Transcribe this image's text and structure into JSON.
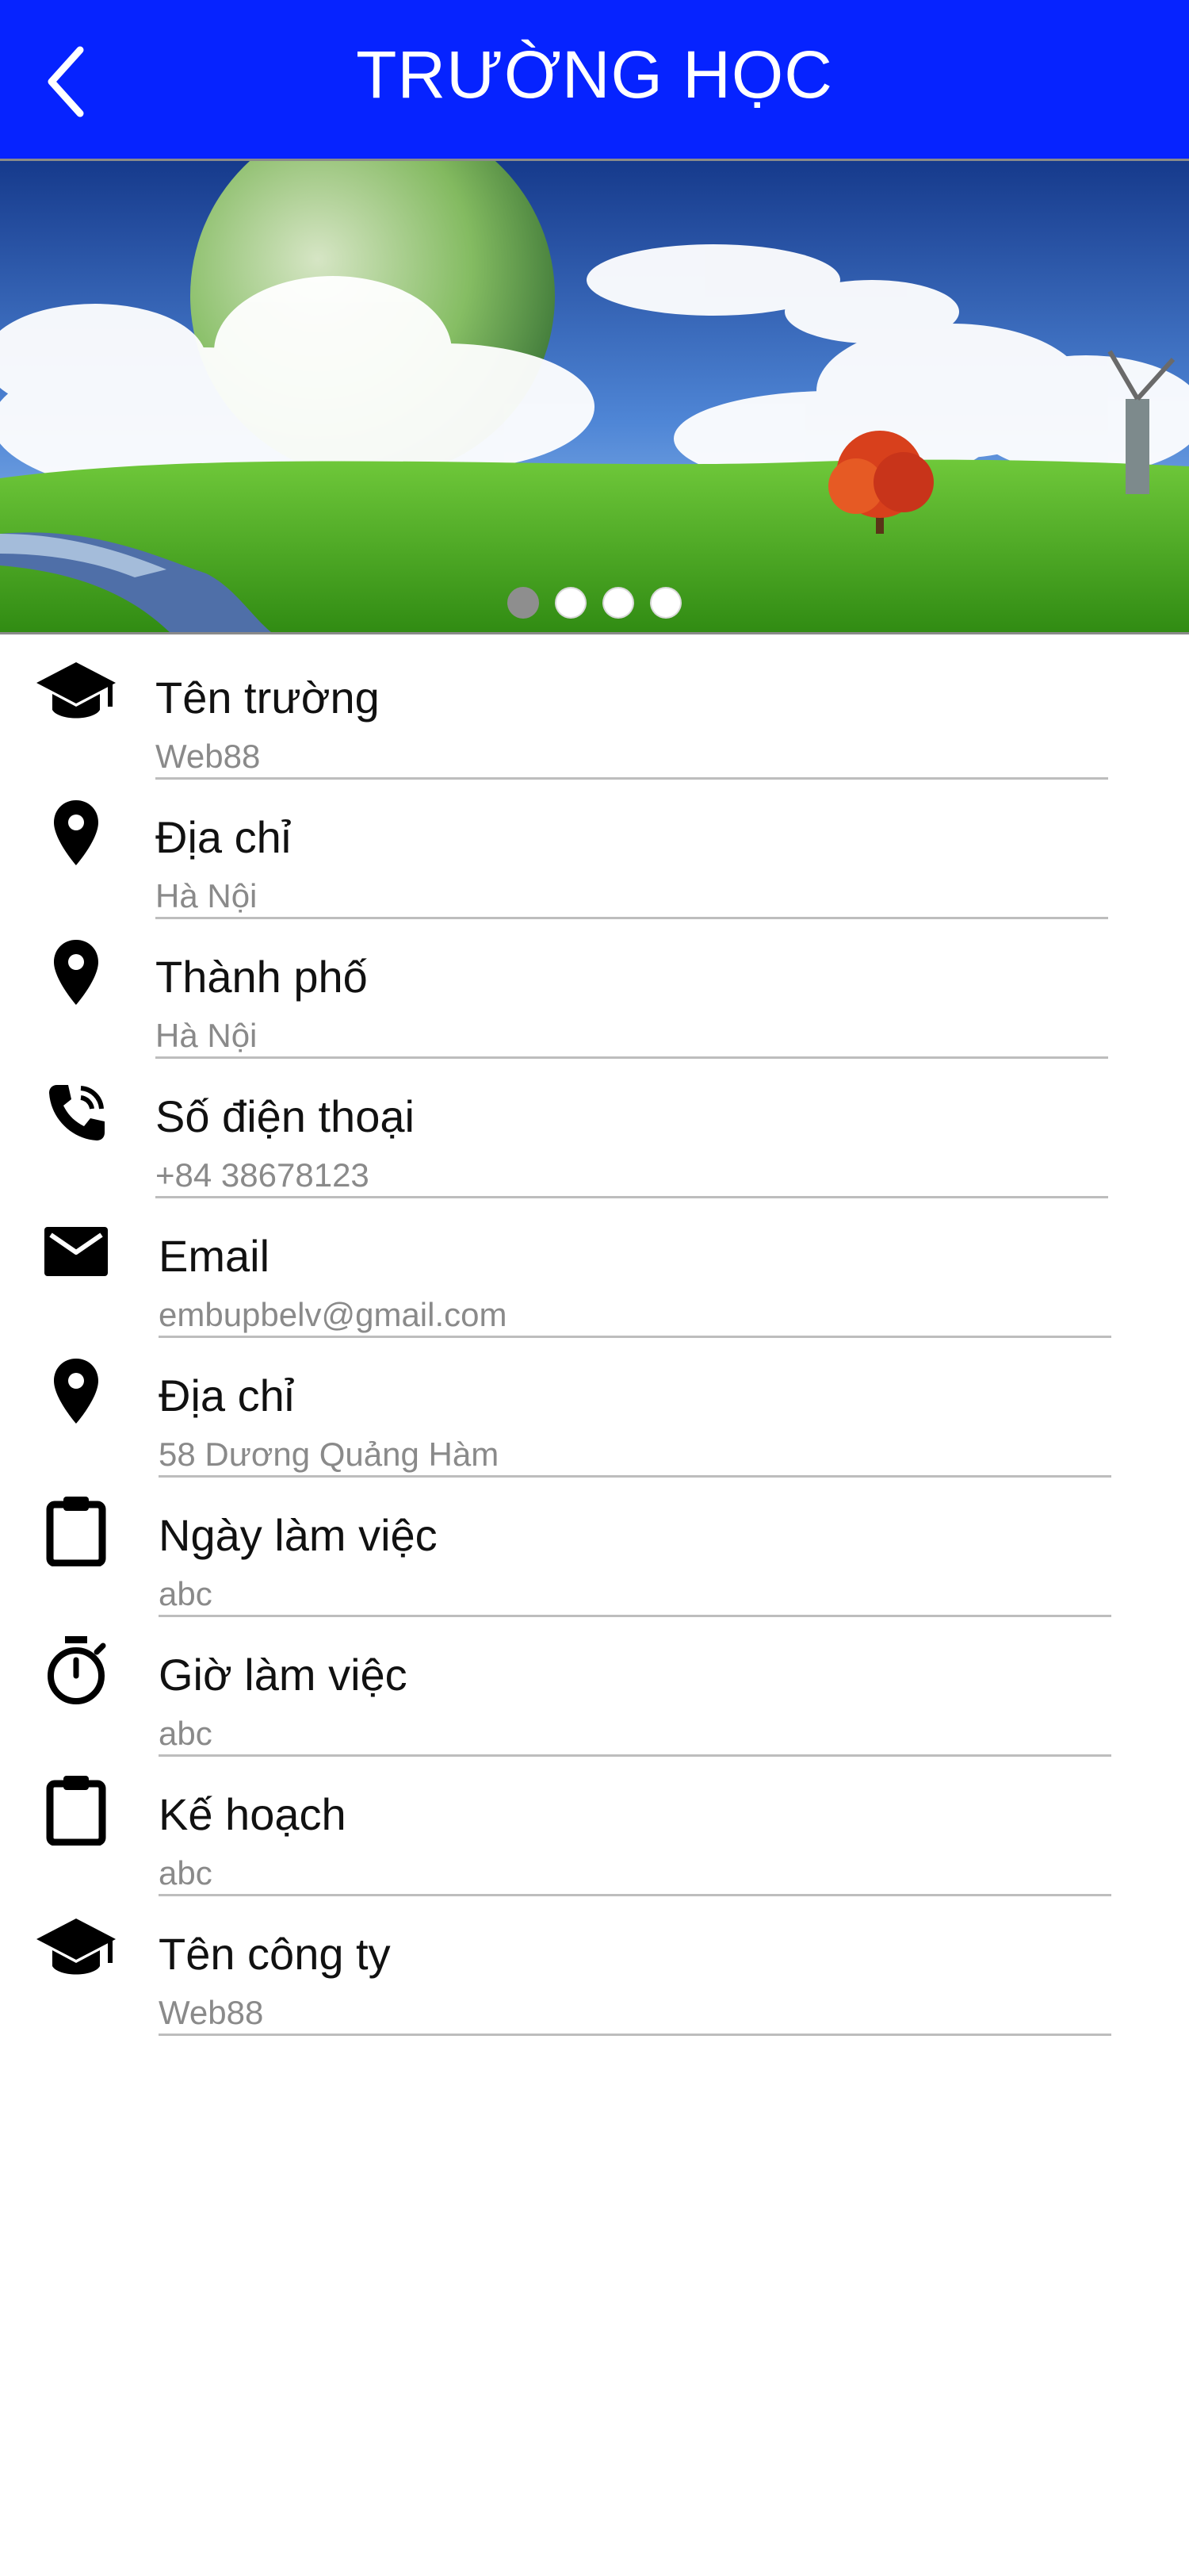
{
  "header": {
    "title": "TRƯỜNG HỌC",
    "back_icon": "chevron-left-icon",
    "background": "#0623ff"
  },
  "banner": {
    "slide_count": 4,
    "active_slide": 1
  },
  "fields": [
    {
      "icon": "graduation-cap-icon",
      "label": "Tên trường",
      "value": "Web88"
    },
    {
      "icon": "map-pin-icon",
      "label": "Địa chỉ",
      "value": "Hà Nội"
    },
    {
      "icon": "map-pin-icon",
      "label": "Thành phố",
      "value": "Hà Nội"
    },
    {
      "icon": "phone-icon",
      "label": "Số điện thoại",
      "value": "+84 38678123"
    },
    {
      "icon": "envelope-icon",
      "label": "Email",
      "value": "embupbelv@gmail.com"
    },
    {
      "icon": "map-pin-icon",
      "label": "Địa chỉ",
      "value": "58 Dương Quảng Hàm"
    },
    {
      "icon": "clipboard-icon",
      "label": "Ngày làm việc",
      "value": "abc"
    },
    {
      "icon": "stopwatch-icon",
      "label": "Giờ làm việc",
      "value": "abc"
    },
    {
      "icon": "clipboard-icon",
      "label": "Kế hoạch",
      "value": "abc"
    },
    {
      "icon": "graduation-cap-icon",
      "label": "Tên công ty",
      "value": "Web88"
    }
  ]
}
